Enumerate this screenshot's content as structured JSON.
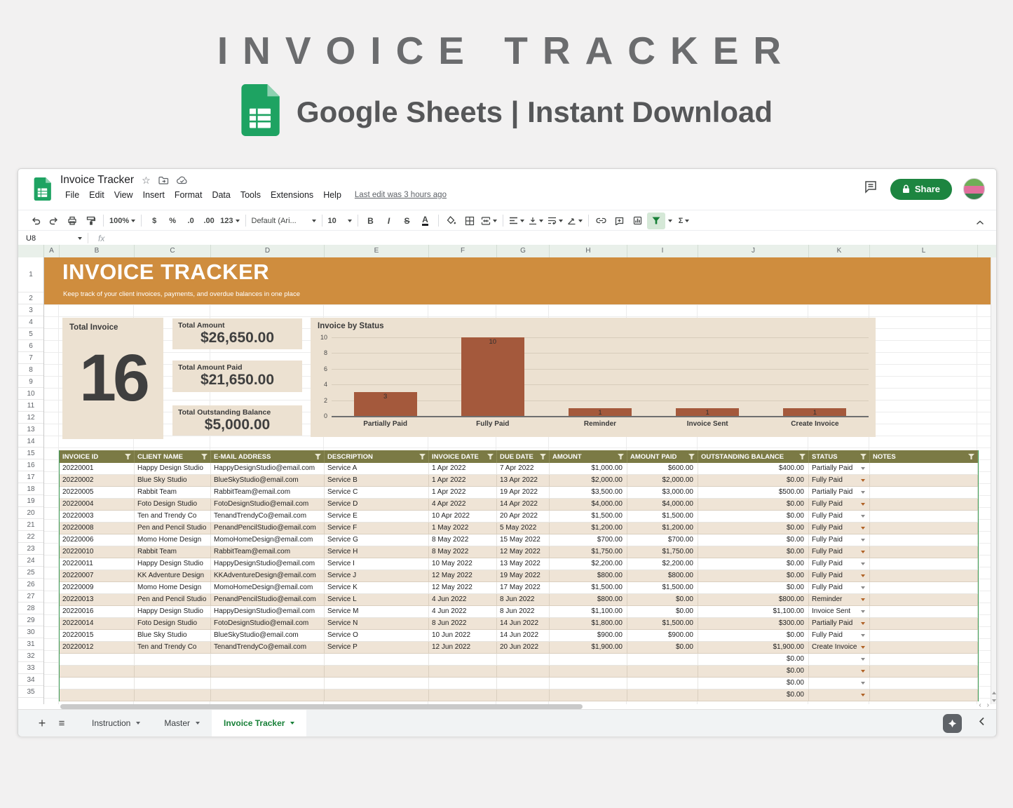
{
  "hero": {
    "title": "INVOICE TRACKER",
    "subtitle": "Google Sheets | Instant Download",
    "icon": "google-sheets-icon"
  },
  "app": {
    "titlebar": {
      "doc_title": "Invoice Tracker",
      "icons": [
        "star-icon",
        "move-folder-icon",
        "cloud-saved-icon"
      ],
      "right_icons": [
        "comment-history-icon",
        "avatar"
      ],
      "share_label": "Share"
    },
    "menubar": {
      "items": [
        "File",
        "Edit",
        "View",
        "Insert",
        "Format",
        "Data",
        "Tools",
        "Extensions",
        "Help"
      ],
      "last_edit": "Last edit was 3 hours ago"
    },
    "toolbar": {
      "zoom": "100%",
      "currency": "$",
      "percent": "%",
      "decrease_decimal": ".0",
      "increase_decimal": ".00",
      "more_formats": "123",
      "font_name": "Default (Ari...",
      "font_size": "10",
      "bold": "B",
      "italic": "I",
      "strikethrough": "S",
      "text_color": "A",
      "functions": "Σ",
      "icon_names": [
        "undo-icon",
        "redo-icon",
        "print-icon",
        "paint-format-icon",
        "fill-color-icon",
        "borders-icon",
        "merge-cells-icon",
        "horizontal-align-icon",
        "vertical-align-icon",
        "text-wrap-icon",
        "text-rotate-icon",
        "insert-link-icon",
        "insert-comment-icon",
        "insert-chart-icon",
        "filter-icon",
        "functions-icon",
        "collapse-toolbar-icon"
      ]
    },
    "formula_bar": {
      "name_box": "U8",
      "fx_label": "fx"
    }
  },
  "sheet": {
    "column_letters": [
      "A",
      "B",
      "C",
      "D",
      "E",
      "F",
      "G",
      "H",
      "I",
      "J",
      "K",
      "L"
    ],
    "row_count": 35,
    "banner": {
      "title": "INVOICE TRACKER",
      "subtitle": "Keep track of your client invoices, payments, and overdue balances in one place"
    },
    "summary": {
      "total_invoice_label": "Total Invoice",
      "total_invoice_value": "16",
      "cards": [
        {
          "label": "Total Amount",
          "value": "$26,650.00"
        },
        {
          "label": "Total Amount Paid",
          "value": "$21,650.00"
        },
        {
          "label": "Total Outstanding Balance",
          "value": "$5,000.00"
        }
      ]
    },
    "table": {
      "headers": [
        "INVOICE ID",
        "CLIENT NAME",
        "E-MAIL ADDRESS",
        "DESCRIPTION",
        "INVOICE DATE",
        "DUE DATE",
        "AMOUNT",
        "AMOUNT PAID",
        "OUTSTANDING BALANCE",
        "STATUS",
        "NOTES"
      ],
      "rows": [
        {
          "id": "20220001",
          "client": "Happy Design Studio",
          "email": "HappyDesignStudio@email.com",
          "desc": "Service A",
          "invoice_date": "1 Apr 2022",
          "due_date": "7 Apr 2022",
          "amount": "$1,000.00",
          "paid": "$600.00",
          "balance": "$400.00",
          "status": "Partially Paid",
          "notes": ""
        },
        {
          "id": "20220002",
          "client": "Blue Sky Studio",
          "email": "BlueSkyStudio@email.com",
          "desc": "Service B",
          "invoice_date": "1 Apr 2022",
          "due_date": "13 Apr 2022",
          "amount": "$2,000.00",
          "paid": "$2,000.00",
          "balance": "$0.00",
          "status": "Fully Paid",
          "notes": ""
        },
        {
          "id": "20220005",
          "client": "Rabbit Team",
          "email": "RabbitTeam@email.com",
          "desc": "Service C",
          "invoice_date": "1 Apr 2022",
          "due_date": "19 Apr 2022",
          "amount": "$3,500.00",
          "paid": "$3,000.00",
          "balance": "$500.00",
          "status": "Partially Paid",
          "notes": ""
        },
        {
          "id": "20220004",
          "client": "Foto Design Studio",
          "email": "FotoDesignStudio@email.com",
          "desc": "Service D",
          "invoice_date": "4 Apr 2022",
          "due_date": "14 Apr 2022",
          "amount": "$4,000.00",
          "paid": "$4,000.00",
          "balance": "$0.00",
          "status": "Fully Paid",
          "notes": ""
        },
        {
          "id": "20220003",
          "client": "Ten and Trendy Co",
          "email": "TenandTrendyCo@email.com",
          "desc": "Service E",
          "invoice_date": "10 Apr 2022",
          "due_date": "20 Apr 2022",
          "amount": "$1,500.00",
          "paid": "$1,500.00",
          "balance": "$0.00",
          "status": "Fully Paid",
          "notes": ""
        },
        {
          "id": "20220008",
          "client": "Pen and Pencil Studio",
          "email": "PenandPencilStudio@email.com",
          "desc": "Service F",
          "invoice_date": "1 May 2022",
          "due_date": "5 May 2022",
          "amount": "$1,200.00",
          "paid": "$1,200.00",
          "balance": "$0.00",
          "status": "Fully Paid",
          "notes": ""
        },
        {
          "id": "20220006",
          "client": "Momo Home Design",
          "email": "MomoHomeDesign@email.com",
          "desc": "Service G",
          "invoice_date": "8 May 2022",
          "due_date": "15 May 2022",
          "amount": "$700.00",
          "paid": "$700.00",
          "balance": "$0.00",
          "status": "Fully Paid",
          "notes": ""
        },
        {
          "id": "20220010",
          "client": "Rabbit Team",
          "email": "RabbitTeam@email.com",
          "desc": "Service H",
          "invoice_date": "8 May 2022",
          "due_date": "12 May 2022",
          "amount": "$1,750.00",
          "paid": "$1,750.00",
          "balance": "$0.00",
          "status": "Fully Paid",
          "notes": ""
        },
        {
          "id": "20220011",
          "client": "Happy Design Studio",
          "email": "HappyDesignStudio@email.com",
          "desc": "Service I",
          "invoice_date": "10 May 2022",
          "due_date": "13 May 2022",
          "amount": "$2,200.00",
          "paid": "$2,200.00",
          "balance": "$0.00",
          "status": "Fully Paid",
          "notes": ""
        },
        {
          "id": "20220007",
          "client": "KK Adventure Design",
          "email": "KKAdventureDesign@email.com",
          "desc": "Service J",
          "invoice_date": "12 May 2022",
          "due_date": "19 May 2022",
          "amount": "$800.00",
          "paid": "$800.00",
          "balance": "$0.00",
          "status": "Fully Paid",
          "notes": ""
        },
        {
          "id": "20220009",
          "client": "Momo Home Design",
          "email": "MomoHomeDesign@email.com",
          "desc": "Service K",
          "invoice_date": "12 May 2022",
          "due_date": "17 May 2022",
          "amount": "$1,500.00",
          "paid": "$1,500.00",
          "balance": "$0.00",
          "status": "Fully Paid",
          "notes": ""
        },
        {
          "id": "20220013",
          "client": "Pen and Pencil Studio",
          "email": "PenandPencilStudio@email.com",
          "desc": "Service L",
          "invoice_date": "4 Jun 2022",
          "due_date": "8 Jun 2022",
          "amount": "$800.00",
          "paid": "$0.00",
          "balance": "$800.00",
          "status": "Reminder",
          "notes": ""
        },
        {
          "id": "20220016",
          "client": "Happy Design Studio",
          "email": "HappyDesignStudio@email.com",
          "desc": "Service M",
          "invoice_date": "4 Jun 2022",
          "due_date": "8 Jun 2022",
          "amount": "$1,100.00",
          "paid": "$0.00",
          "balance": "$1,100.00",
          "status": "Invoice Sent",
          "notes": ""
        },
        {
          "id": "20220014",
          "client": "Foto Design Studio",
          "email": "FotoDesignStudio@email.com",
          "desc": "Service N",
          "invoice_date": "8 Jun 2022",
          "due_date": "14 Jun 2022",
          "amount": "$1,800.00",
          "paid": "$1,500.00",
          "balance": "$300.00",
          "status": "Partially Paid",
          "notes": ""
        },
        {
          "id": "20220015",
          "client": "Blue Sky Studio",
          "email": "BlueSkyStudio@email.com",
          "desc": "Service O",
          "invoice_date": "10 Jun 2022",
          "due_date": "14 Jun 2022",
          "amount": "$900.00",
          "paid": "$900.00",
          "balance": "$0.00",
          "status": "Fully Paid",
          "notes": ""
        },
        {
          "id": "20220012",
          "client": "Ten and Trendy Co",
          "email": "TenandTrendyCo@email.com",
          "desc": "Service P",
          "invoice_date": "12 Jun 2022",
          "due_date": "20 Jun 2022",
          "amount": "$1,900.00",
          "paid": "$0.00",
          "balance": "$1,900.00",
          "status": "Create Invoice",
          "notes": ""
        }
      ],
      "empty_rows": [
        {
          "balance": "$0.00"
        },
        {
          "balance": "$0.00"
        },
        {
          "balance": "$0.00"
        },
        {
          "balance": "$0.00"
        }
      ]
    }
  },
  "chart_data": {
    "type": "bar",
    "title": "Invoice by Status",
    "categories": [
      "Partially Paid",
      "Fully Paid",
      "Reminder",
      "Invoice Sent",
      "Create Invoice"
    ],
    "values": [
      3,
      10,
      1,
      1,
      1
    ],
    "xlabel": "",
    "ylabel": "",
    "ylim": [
      0,
      10
    ],
    "yticks": [
      0,
      2,
      4,
      6,
      8,
      10
    ],
    "grid": true,
    "legend": "none",
    "bar_color": "#a4593c"
  },
  "tabbar": {
    "add_icon": "plus-icon",
    "all_sheets_icon": "all-sheets-icon",
    "tabs": [
      {
        "label": "Instruction",
        "active": false
      },
      {
        "label": "Master",
        "active": false
      },
      {
        "label": "Invoice Tracker",
        "active": true
      }
    ],
    "right_icons": [
      "explore-icon",
      "chevron-left-icon"
    ]
  },
  "colors": {
    "banner_orange": "#cf8d3e",
    "panel_beige": "#ece1d1",
    "bar_brown": "#a4593c",
    "table_header_olive": "#7b7a45",
    "row_alt_beige": "#efe4d6",
    "accent_green": "#188038",
    "share_green": "#1d8540"
  }
}
